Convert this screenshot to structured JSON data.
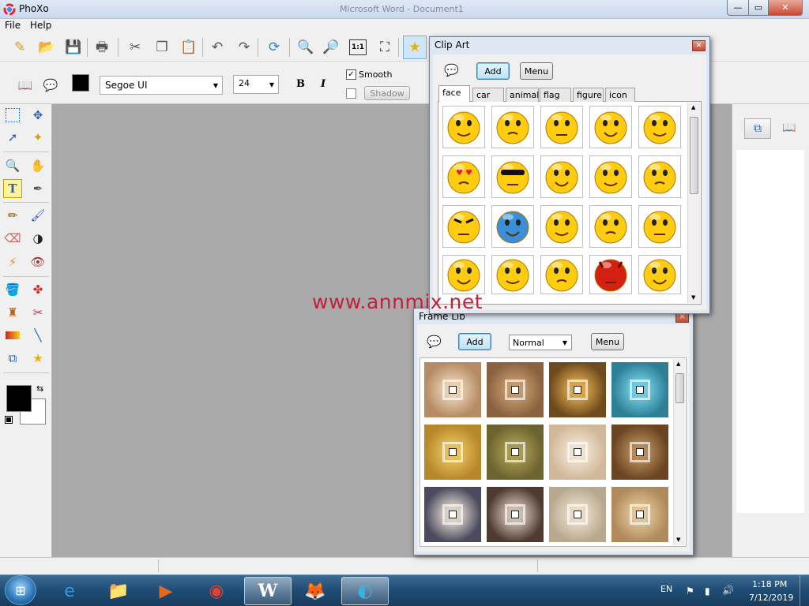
{
  "window": {
    "title": "PhoXo",
    "ghost_title": "Microsoft Word - Document1",
    "min": "—",
    "max": "▭",
    "close": "✕"
  },
  "menu": [
    {
      "label": "File"
    },
    {
      "label": "Help"
    }
  ],
  "text_options": {
    "font": "Segoe UI",
    "size": "24",
    "bold": "B",
    "italic": "I",
    "smooth_label": "Smooth",
    "smooth_checked": true,
    "shadow_label": "Shadow",
    "color": "#000000"
  },
  "clip_art": {
    "title": "Clip Art",
    "add_label": "Add",
    "menu_label": "Menu",
    "tabs": [
      "face",
      "car",
      "animal",
      "flag",
      "figure",
      "icon"
    ],
    "active_tab": "face",
    "items": [
      "dizzy-face",
      "surprised-face",
      "sleepy-face",
      "bandaged-face",
      "hurt-face",
      "love-face",
      "cool-face",
      "sweat-face",
      "laughing-face",
      "confused-face",
      "angry-face",
      "cold-face",
      "scolding-face",
      "crying-face",
      "sad-face",
      "shocked-face",
      "drooling-face",
      "grinning-face",
      "devil-face",
      "drumming-face"
    ]
  },
  "frame_lib": {
    "title": "Frame Lib",
    "add_label": "Add",
    "mode_value": "Normal",
    "menu_label": "Menu",
    "frames": [
      {
        "outer": "#b58a64",
        "mid": "#e8d0b0",
        "name": "frame-1"
      },
      {
        "outer": "#8a6240",
        "mid": "#c49a6c",
        "name": "frame-2"
      },
      {
        "outer": "#6e4a1e",
        "mid": "#d9a64a",
        "name": "frame-3"
      },
      {
        "outer": "#2c7f95",
        "mid": "#6fcbe0",
        "name": "frame-4"
      },
      {
        "outer": "#b8872a",
        "mid": "#e6c05a",
        "name": "frame-5"
      },
      {
        "outer": "#6b6330",
        "mid": "#a89a50",
        "name": "frame-6"
      },
      {
        "outer": "#d2b89a",
        "mid": "#f0e2d0",
        "name": "frame-7"
      },
      {
        "outer": "#6b4422",
        "mid": "#b48a58",
        "name": "frame-8"
      },
      {
        "outer": "#4c4a5e",
        "mid": "#d8d0c8",
        "name": "frame-9"
      },
      {
        "outer": "#4e3a30",
        "mid": "#cbbcb0",
        "name": "frame-10"
      },
      {
        "outer": "#b8a890",
        "mid": "#e8dcc8",
        "name": "frame-11"
      },
      {
        "outer": "#b08a5a",
        "mid": "#e0c49a",
        "name": "frame-12"
      }
    ]
  },
  "watermark": "www.annmix.net",
  "taskbar": {
    "apps": [
      {
        "name": "ie-icon",
        "glyph": "e"
      },
      {
        "name": "explorer-icon",
        "glyph": "📁"
      },
      {
        "name": "media-player-icon",
        "glyph": "▶"
      },
      {
        "name": "chrome-icon",
        "glyph": "◉"
      },
      {
        "name": "word-icon",
        "glyph": "W"
      },
      {
        "name": "firefox-icon",
        "glyph": "🦊"
      },
      {
        "name": "phoxo-icon",
        "glyph": "◐"
      }
    ],
    "language": "EN",
    "time": "1:18 PM",
    "date": "7/12/2019"
  }
}
